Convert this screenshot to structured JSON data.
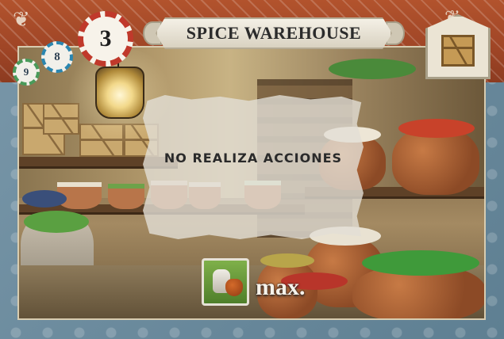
{
  "card": {
    "title": "SPICE WAREHOUSE",
    "overlay_text": "NO REALIZA ACCIONES",
    "bonus_label": "max.",
    "numbers": {
      "main": "3",
      "secondary": "8",
      "tertiary": "9"
    }
  },
  "icons": {
    "building_icon": "crate-icon",
    "bonus_icon": "spice-icon"
  },
  "colors": {
    "top_band": "#b2532d",
    "border": "#7f9fb1",
    "title_banner": "#f4f0e6",
    "bonus_green": "#7fb04a"
  }
}
